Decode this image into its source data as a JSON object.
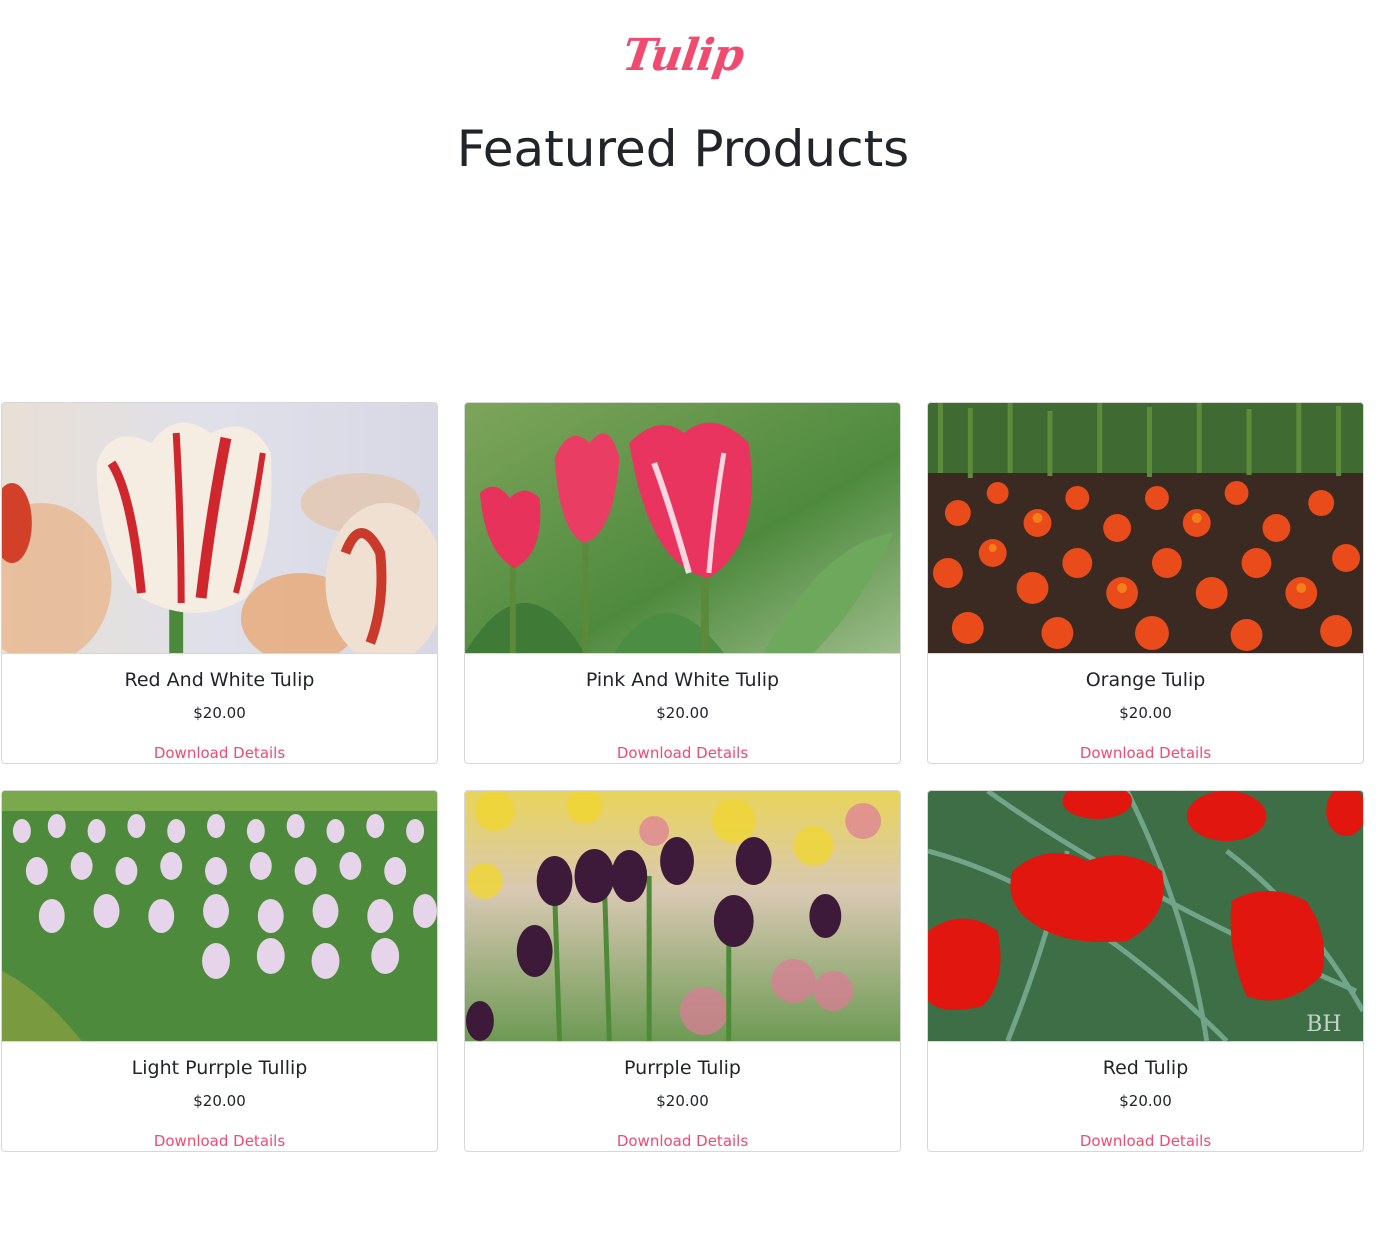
{
  "brand": {
    "logo_text": "Tulip",
    "accent_color": "#f14a6f"
  },
  "page": {
    "title": "Featured Products"
  },
  "products": [
    {
      "name": "Red And White Tulip",
      "price": "$20.00",
      "link_label": "Download Details",
      "image": "red-white-tulip-photo"
    },
    {
      "name": "Pink And White Tulip",
      "price": "$20.00",
      "link_label": "Download Details",
      "image": "pink-white-tulip-photo"
    },
    {
      "name": "Orange Tulip",
      "price": "$20.00",
      "link_label": "Download Details",
      "image": "orange-tulip-field-photo"
    },
    {
      "name": "Light Purrple Tullip",
      "price": "$20.00",
      "link_label": "Download Details",
      "image": "light-purple-tulip-field-photo"
    },
    {
      "name": "Purrple Tulip",
      "price": "$20.00",
      "link_label": "Download Details",
      "image": "purple-tulip-photo"
    },
    {
      "name": "Red Tulip",
      "price": "$20.00",
      "link_label": "Download Details",
      "image": "red-tulip-photo"
    }
  ]
}
